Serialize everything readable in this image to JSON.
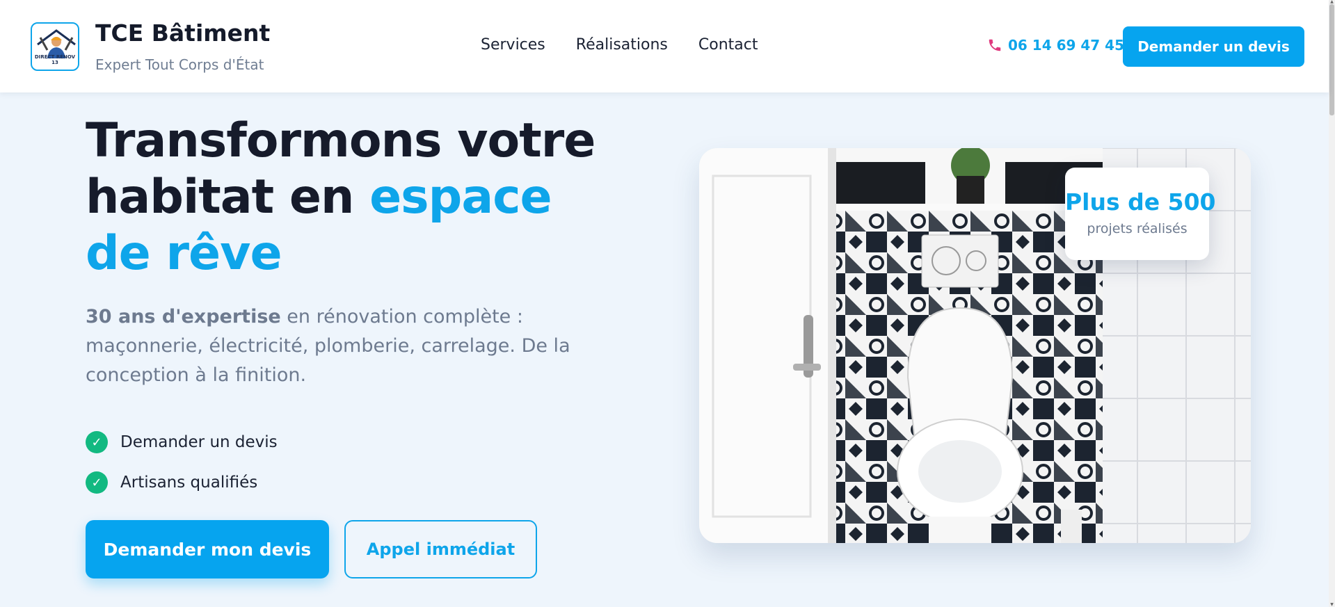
{
  "brand": {
    "logo_text": "DIRECT RÉNOV 13",
    "name": "TCE Bâtiment",
    "tagline": "Expert Tout Corps d'État"
  },
  "nav": {
    "items": [
      {
        "label": "Services"
      },
      {
        "label": "Réalisations"
      },
      {
        "label": "Contact"
      }
    ]
  },
  "header": {
    "phone": "06 14 69 47 45",
    "cta_label": "Demander un devis"
  },
  "hero": {
    "title_part1": "Transformons votre habitat en ",
    "title_accent": "espace de rêve",
    "desc_bold": "30 ans d'expertise",
    "desc_rest": " en rénovation complète : maçonnerie, électricité, plomberie, carrelage. De la conception à la finition.",
    "checks": [
      {
        "label": "Demander un devis"
      },
      {
        "label": "Artisans qualifiés"
      }
    ],
    "primary_button": "Demander mon devis",
    "secondary_button": "Appel immédiat"
  },
  "stat_card": {
    "value": "Plus de 500",
    "label": "projets réalisés"
  },
  "colors": {
    "accent": "#0ea5ea",
    "button": "#06a4ef",
    "check": "#12b981",
    "phone_icon": "#e0397e",
    "heading": "#161b2b",
    "muted": "#6d7a8f",
    "page_bg": "#eef5fc"
  },
  "icons": {
    "phone": "phone-icon",
    "check": "check-icon",
    "logo": "worker-logo-icon"
  }
}
